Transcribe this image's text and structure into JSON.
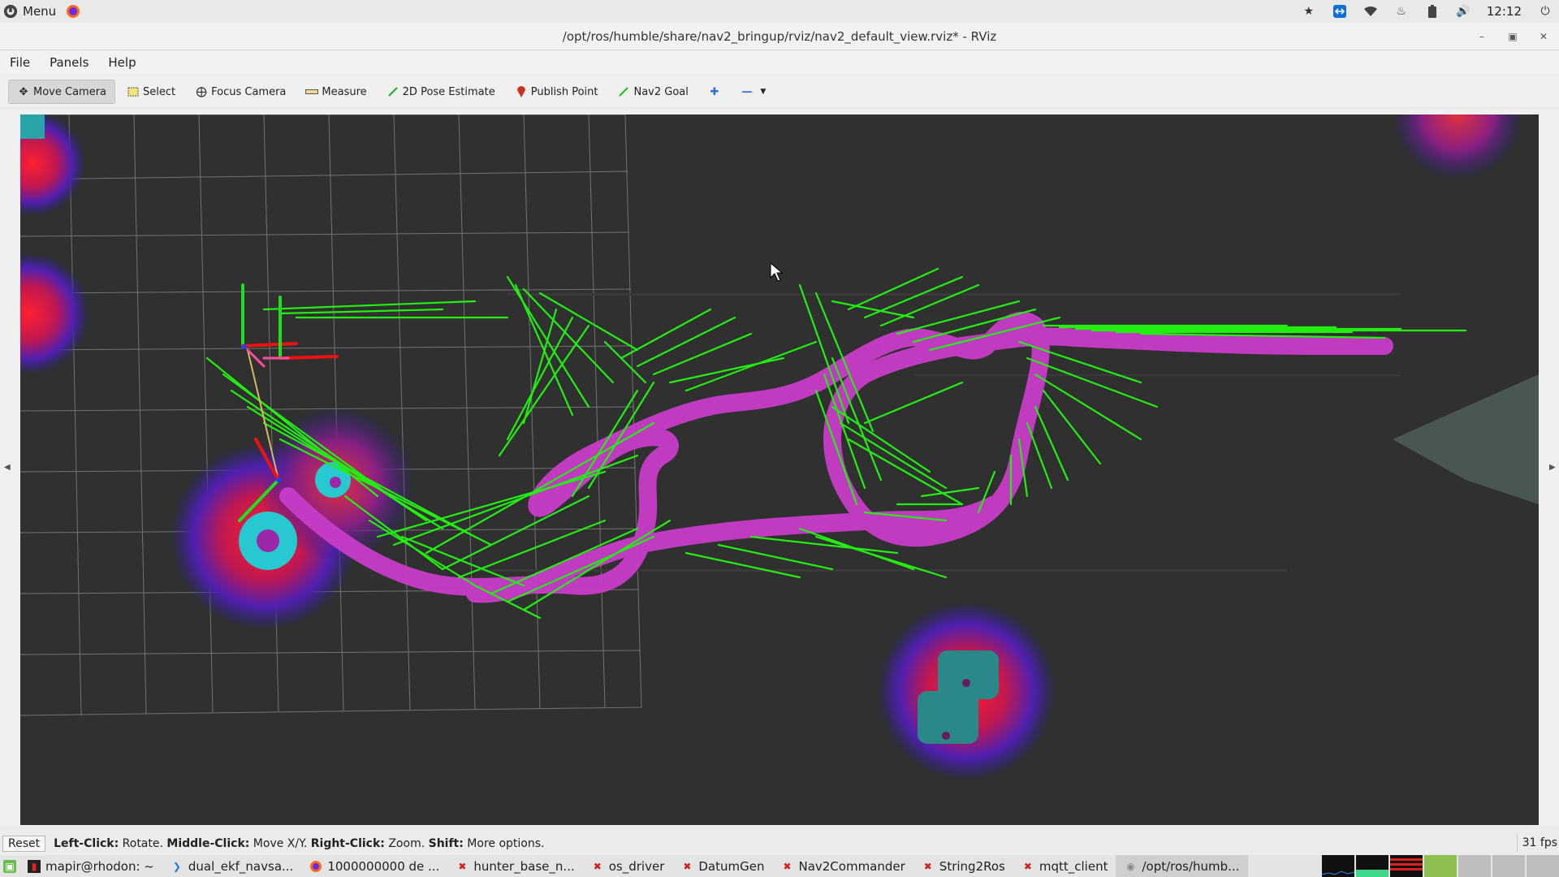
{
  "top_panel": {
    "menu_label": "Menu",
    "clock": "12:12",
    "tray_icons": [
      "bluetooth-icon",
      "teamviewer-icon",
      "wifi-icon",
      "notification-icon",
      "battery-icon",
      "volume-icon",
      "power-icon"
    ]
  },
  "window": {
    "title": "/opt/ros/humble/share/nav2_bringup/rviz/nav2_default_view.rviz* - RViz"
  },
  "menubar": {
    "items": [
      "File",
      "Panels",
      "Help"
    ]
  },
  "toolbar": {
    "tools": [
      {
        "label": "Move Camera",
        "icon": "move-camera-icon",
        "active": true
      },
      {
        "label": "Select",
        "icon": "select-icon"
      },
      {
        "label": "Focus Camera",
        "icon": "focus-camera-icon"
      },
      {
        "label": "Measure",
        "icon": "measure-icon"
      },
      {
        "label": "2D Pose Estimate",
        "icon": "pose-estimate-icon"
      },
      {
        "label": "Publish Point",
        "icon": "publish-point-icon"
      },
      {
        "label": "Nav2 Goal",
        "icon": "nav2-goal-icon"
      }
    ]
  },
  "statusbar": {
    "reset_label": "Reset",
    "hint_parts": [
      {
        "bold": "Left-Click:",
        "text": " Rotate. "
      },
      {
        "bold": "Middle-Click:",
        "text": " Move X/Y. "
      },
      {
        "bold": "Right-Click:",
        "text": " Zoom. "
      },
      {
        "bold": "Shift:",
        "text": " More options."
      }
    ],
    "fps": "31 fps"
  },
  "taskbar": {
    "tasks": [
      {
        "label": "mapir@rhodon: ~",
        "icon": "terminal-icon"
      },
      {
        "label": "dual_ekf_navsa...",
        "icon": "vscode-icon"
      },
      {
        "label": "1000000000 de ...",
        "icon": "firefox-icon"
      },
      {
        "label": "hunter_base_n...",
        "icon": "ros-icon"
      },
      {
        "label": "os_driver",
        "icon": "ros-icon"
      },
      {
        "label": "DatumGen",
        "icon": "ros-icon"
      },
      {
        "label": "Nav2Commander",
        "icon": "ros-icon"
      },
      {
        "label": "String2Ros",
        "icon": "ros-icon"
      },
      {
        "label": "mqtt_client",
        "icon": "ros-icon"
      },
      {
        "label": "/opt/ros/humb...",
        "icon": "rviz-icon",
        "active": true
      }
    ]
  },
  "colors": {
    "viewport_bg": "#303030",
    "grid": "#8a8a8a",
    "path": "#c83cc8",
    "arrows": "#22ee11",
    "costmap_cyan": "#28c8d0",
    "costmap_teal": "#2a8888",
    "inflation_red": "#d02040",
    "inflation_blue": "#3020a0"
  }
}
